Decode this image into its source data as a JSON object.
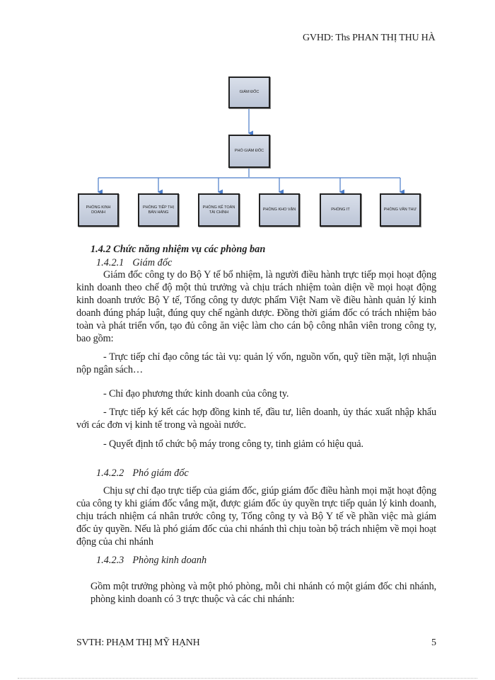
{
  "header": {
    "supervisor": "GVHD: Ths PHAN THỊ THU HÀ"
  },
  "diagram": {
    "top": "GIÁM ĐỐC",
    "middle": "PHÓ GIÁM ĐỐC",
    "departments": [
      "PHÒNG KINH DOANH",
      "PHÒNG TIẾP THỊ BÁN HÀNG",
      "PHÒNG KẾ TOÁN TÀI CHÍNH",
      "PHÒNG KHO VẬN",
      "PHÒNG IT",
      "PHÒNG VĂN THƯ"
    ],
    "box_fill": "#c8d0e0",
    "connector_color": "#4a7cc9"
  },
  "section": {
    "title": "1.4.2 Chức năng nhiệm vụ các phòng ban",
    "s1": {
      "num": "1.4.2.1",
      "title": "Giám đốc",
      "para": "Giám đốc công ty do Bộ Y tế bổ nhiệm, là người điều hành trực tiếp mọi hoạt động kinh doanh theo chế độ một thủ trưởng và chịu trách nhiệm toàn diện về mọi hoạt động kinh doanh trước Bộ Y tế, Tổng công ty dược phẩm Việt Nam về điều hành quản lý kinh doanh đúng pháp luật, đúng quy chế ngành dược. Đồng thời giám đốc có trách nhiệm bảo toàn và phát triển vốn, tạo đủ công ăn việc làm cho cán bộ công nhân viên trong công ty, bao gồm:",
      "bullets": [
        "-   Trực tiếp chỉ đạo công tác tài vụ: quản lý vốn, nguồn vốn, quỹ tiền mặt, lợi nhuận nộp ngân sách…",
        "-   Chỉ đạo phương thức kinh doanh của công ty.",
        "-   Trực tiếp ký kết các hợp đồng kinh tế, đầu tư, liên doanh, ủy thác xuất nhập khẩu với các đơn vị kinh tế trong và ngoài nước.",
        "- Quyết định tổ chức bộ máy trong công ty, tinh giảm có hiệu quả."
      ]
    },
    "s2": {
      "num": "1.4.2.2",
      "title": "Phó giám đốc",
      "para": "Chịu sự chỉ đạo trực tiếp của giám đốc, giúp giám đốc điều hành mọi mặt hoạt động của công ty khi giám đốc vắng mặt, được giám đốc ủy quyền trực tiếp quản lý kinh doanh, chịu trách nhiệm cá nhân trước công ty, Tổng công ty và Bộ Y tế về phần việc mà giám đốc ủy quyền. Nếu là phó giám đốc của chi nhánh thì chịu toàn bộ trách nhiệm về mọi hoạt động của chi nhánh"
    },
    "s3": {
      "num": "1.4.2.3",
      "title": "Phòng kinh doanh",
      "para": "Gồm một trưởng phòng và một phó phòng, mỗi chi nhánh có một giám đốc chi nhánh, phòng kinh doanh có 3 trực thuộc và các chi nhánh:"
    }
  },
  "footer": {
    "student": "SVTH: PHẠM THỊ MỸ HẠNH",
    "page": "5"
  }
}
